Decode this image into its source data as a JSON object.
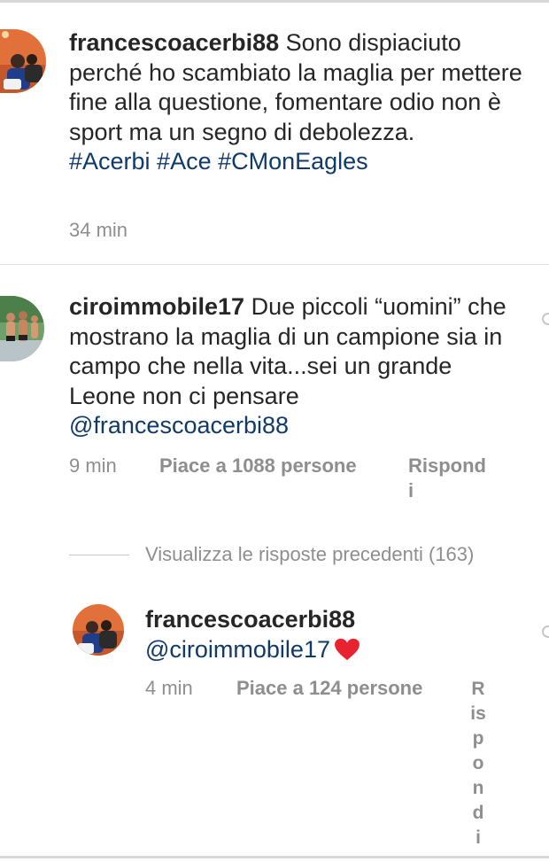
{
  "comments": [
    {
      "username": "francescoacerbi88",
      "text": " Sono dispiaciuto perché ho scambiato la maglia per mettere fine alla questione, fomentare odio non è sport ma un segno di debolezza.",
      "hashtags": "#Acerbi #Ace #CMonEagles",
      "time": "34 min"
    },
    {
      "username": "ciroimmobile17",
      "text": " Due piccoli “uomini” che mostrano la maglia di un campione sia in campo che nella vita...sei un grande Leone non ci pensare",
      "mention": "@francescoacerbi88",
      "time": "9 min",
      "likes": "Piace a 1088 persone",
      "reply": "Rispondi"
    }
  ],
  "view_previous": "Visualizza le risposte precedenti (163)",
  "reply_comment": {
    "username": "francescoacerbi88",
    "mention": "@ciroimmobile17",
    "time": "4 min",
    "likes": "Piace a 124 persone",
    "reply": "Rispondi"
  },
  "colors": {
    "text": "#262626",
    "secondary": "#8e8e8e",
    "link": "#0f3a6b",
    "heart": "#e8232f"
  },
  "icons": [
    "avatar-photo",
    "heart-icon",
    "like-heart-icon"
  ]
}
